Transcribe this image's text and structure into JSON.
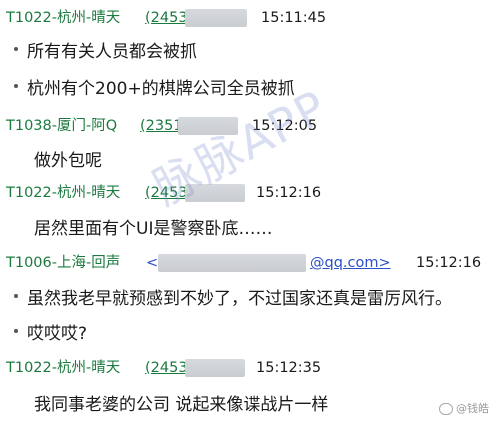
{
  "messages": [
    {
      "sender": "T1022-杭州-晴天",
      "qq": "(2453",
      "time": "15:11:45",
      "lines": [
        "所有有关人员都会被抓",
        "杭州有个200+的棋牌公司全员被抓"
      ]
    },
    {
      "sender": "T1038-厦门-阿Q",
      "qq": "(2351",
      "time": "15:12:05",
      "lines": [
        "做外包呢"
      ]
    },
    {
      "sender": "T1022-杭州-晴天",
      "qq": "(2453",
      "time": "15:12:16",
      "lines": [
        "居然里面有个UI是警察卧底……"
      ]
    },
    {
      "sender": "T1006-上海-回声",
      "qq": "<",
      "qq_suffix": "@qq.com>",
      "time": "15:12:16",
      "lines": [
        "虽然我老早就预感到不妙了，不过国家还真是雷厉风行。",
        "哎哎哎?"
      ]
    },
    {
      "sender": "T1022-杭州-晴天",
      "qq": "(2453",
      "time": "15:12:35",
      "lines": [
        "我同事老婆的公司   说起来像谍战片一样"
      ]
    }
  ],
  "watermark": "脉脉APP",
  "weibo_credit": "@钱皓",
  "colors": {
    "sender": "#1b7a3e",
    "email": "#2b50c8",
    "text": "#1a1a1a"
  }
}
